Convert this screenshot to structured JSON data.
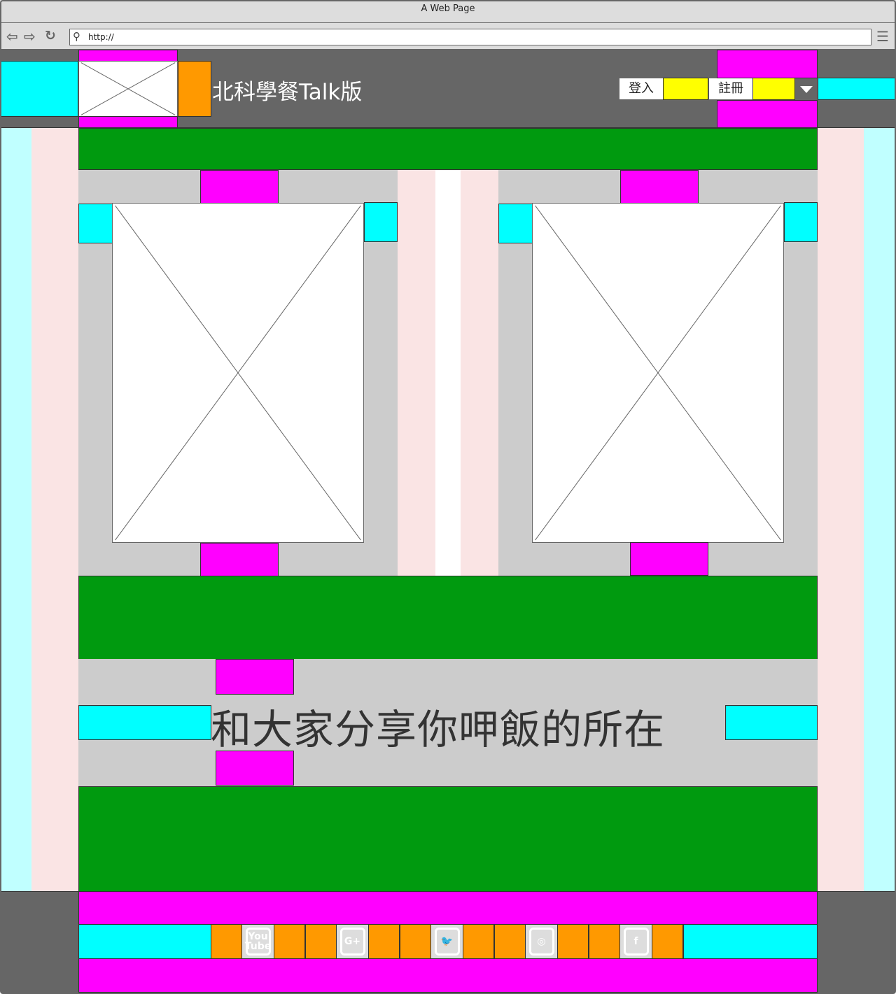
{
  "browser": {
    "title": "A Web Page",
    "url": "http://"
  },
  "header": {
    "site_title": "北科學餐Talk版",
    "login_label": "登入",
    "register_label": "註冊"
  },
  "main": {
    "tagline": "和大家分享你呷飯的所在"
  },
  "footer": {
    "social": [
      {
        "icon": "youtube-icon",
        "text": "You Tube"
      },
      {
        "icon": "google-plus-icon",
        "text": "G+"
      },
      {
        "icon": "twitter-icon",
        "text": "🐦"
      },
      {
        "icon": "instagram-icon",
        "text": "◎"
      },
      {
        "icon": "facebook-icon",
        "text": "f"
      }
    ]
  },
  "colors": {
    "header_bg": "#666666",
    "green": "#009a0f",
    "magenta": "#ff00ff",
    "cyan": "#00ffff",
    "orange": "#ff9900",
    "yellow": "#ffff00"
  }
}
